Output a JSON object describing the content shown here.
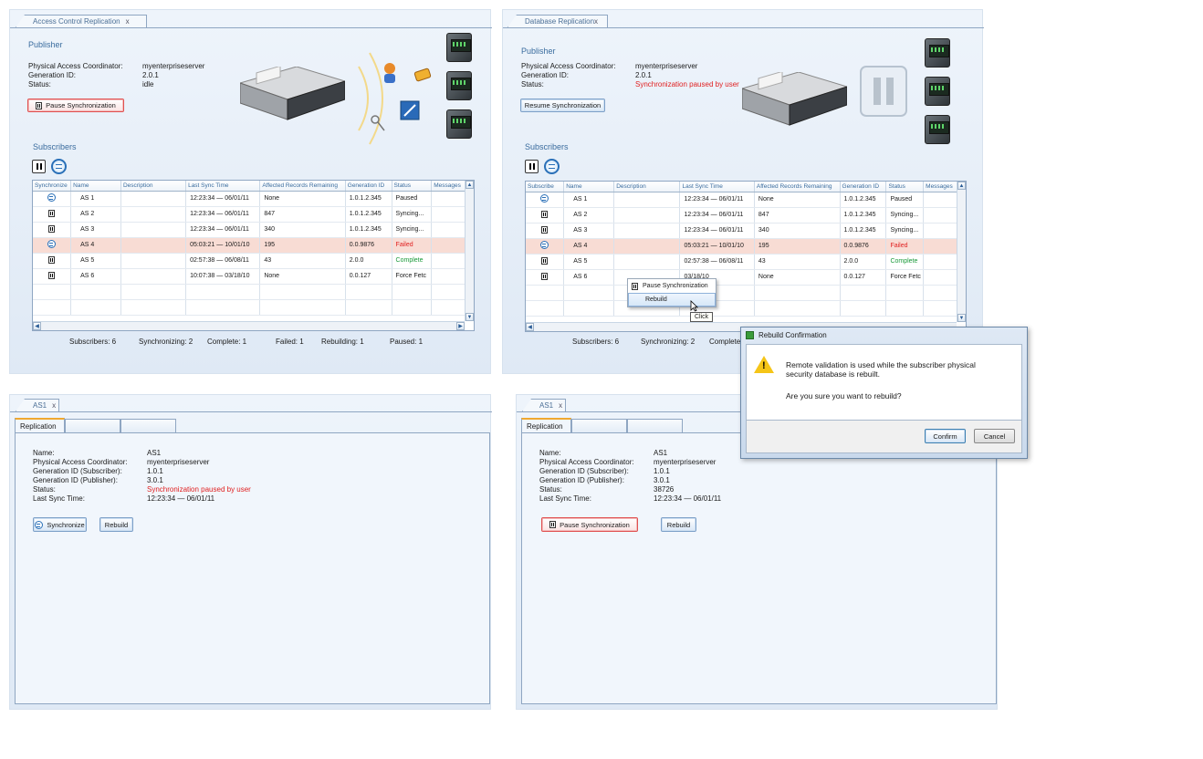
{
  "left_panel": {
    "tab_title": "Access Control Replication",
    "tab_close": "x",
    "publisher_heading": "Publisher",
    "publisher": {
      "pac_label": "Physical Access Coordinator:",
      "pac_value": "myenterpriseserver",
      "gen_label": "Generation ID:",
      "gen_value": "2.0.1",
      "status_label": "Status:",
      "status_value": "idle"
    },
    "action_button": "Pause Synchronization",
    "subscribers_heading": "Subscribers",
    "columns": [
      "Synchronize",
      "Name",
      "Description",
      "Last Sync Time",
      "Affected Records Remaining",
      "Generation ID",
      "Status",
      "Messages"
    ],
    "rows": [
      {
        "icon": "sync",
        "name": "AS 1",
        "desc": "",
        "time": "12:23:34 — 06/01/11",
        "records": "None",
        "gen": "1.0.1.2.345",
        "status": "Paused",
        "status_color": "normal"
      },
      {
        "icon": "pause",
        "name": "AS 2",
        "desc": "",
        "time": "12:23:34 — 06/01/11",
        "records": "847",
        "gen": "1.0.1.2.345",
        "status": "Syncing...",
        "status_color": "normal"
      },
      {
        "icon": "pause",
        "name": "AS 3",
        "desc": "",
        "time": "12:23:34 — 06/01/11",
        "records": "340",
        "gen": "1.0.1.2.345",
        "status": "Syncing...",
        "status_color": "normal"
      },
      {
        "icon": "sync",
        "name": "AS 4",
        "desc": "",
        "time": "05:03:21 — 10/01/10",
        "records": "195",
        "gen": "0.0.9876",
        "status": "Failed",
        "status_color": "red"
      },
      {
        "icon": "pause",
        "name": "AS 5",
        "desc": "",
        "time": "02:57:38 — 06/08/11",
        "records": "43",
        "gen": "2.0.0",
        "status": "Complete",
        "status_color": "green"
      },
      {
        "icon": "pause",
        "name": "AS 6",
        "desc": "",
        "time": "10:07:38 — 03/18/10",
        "records": "None",
        "gen": "0.0.127",
        "status": "Force Fetc",
        "status_color": "normal"
      }
    ],
    "stats": [
      "Subscribers: 6",
      "Synchronizing: 2",
      "Complete: 1",
      "Failed: 1",
      "Rebuilding: 1",
      "Paused: 1"
    ]
  },
  "right_panel": {
    "tab_title": "Database Replication",
    "tab_close": "x",
    "publisher_heading": "Publisher",
    "publisher": {
      "pac_label": "Physical Access Coordinator:",
      "pac_value": "myenterpriseserver",
      "gen_label": "Generation ID:",
      "gen_value": "2.0.1",
      "status_label": "Status:",
      "status_value": "Synchronization paused by user"
    },
    "action_button": "Resume Synchronization",
    "subscribers_heading": "Subscribers",
    "columns": [
      "Subscribe",
      "Name",
      "Description",
      "Last Sync Time",
      "Affected Records Remaining",
      "Generation ID",
      "Status",
      "Messages"
    ],
    "rows": [
      {
        "icon": "sync",
        "name": "AS 1",
        "desc": "",
        "time": "12:23:34 — 06/01/11",
        "records": "None",
        "gen": "1.0.1.2.345",
        "status": "Paused",
        "status_color": "normal"
      },
      {
        "icon": "pause",
        "name": "AS 2",
        "desc": "",
        "time": "12:23:34 — 06/01/11",
        "records": "847",
        "gen": "1.0.1.2.345",
        "status": "Syncing...",
        "status_color": "normal"
      },
      {
        "icon": "pause",
        "name": "AS 3",
        "desc": "",
        "time": "12:23:34 — 06/01/11",
        "records": "340",
        "gen": "1.0.1.2.345",
        "status": "Syncing...",
        "status_color": "normal"
      },
      {
        "icon": "sync",
        "name": "AS 4",
        "desc": "",
        "time": "05:03:21 — 10/01/10",
        "records": "195",
        "gen": "0.0.9876",
        "status": "Failed",
        "status_color": "red"
      },
      {
        "icon": "pause",
        "name": "AS 5",
        "desc": "",
        "time": "02:57:38 — 06/08/11",
        "records": "43",
        "gen": "2.0.0",
        "status": "Complete",
        "status_color": "green"
      },
      {
        "icon": "pause",
        "name": "AS 6",
        "desc": "",
        "time": "03/18/10",
        "records": "None",
        "gen": "0.0.127",
        "status": "Force Fetc",
        "status_color": "normal"
      }
    ],
    "stats": [
      "Subscribers: 6",
      "Synchronizing: 2",
      "Complete"
    ],
    "context_menu": [
      "Pause Synchronization",
      "Rebuild"
    ],
    "tooltip": "Click"
  },
  "dialog": {
    "title": "Rebuild Confirmation",
    "message_1": "Remote validation is used while the subscriber physical",
    "message_2": "security database is rebuilt.",
    "question": "Are you sure you want to rebuild?",
    "confirm": "Confirm",
    "cancel": "Cancel"
  },
  "detail_left": {
    "tab_title": "AS1",
    "tab_close": "x",
    "subtab": "Replication",
    "fields": [
      {
        "label": "Name:",
        "value": "AS1",
        "color": "normal"
      },
      {
        "label": "Physical Access Coordinator:",
        "value": "myenterpriseserver",
        "color": "normal"
      },
      {
        "label": "Generation ID (Subscriber):",
        "value": "1.0.1",
        "color": "normal"
      },
      {
        "label": "Generation ID (Publisher):",
        "value": "3.0.1",
        "color": "normal"
      },
      {
        "label": "Status:",
        "value": "Synchronization paused by user",
        "color": "red"
      },
      {
        "label": "Last Sync Time:",
        "value": "12:23:34 — 06/01/11",
        "color": "normal"
      }
    ],
    "button_1": "Synchronize",
    "button_2": "Rebuild"
  },
  "detail_right": {
    "tab_title": "AS1",
    "tab_close": "x",
    "subtab": "Replication",
    "fields": [
      {
        "label": "Name:",
        "value": "AS1",
        "color": "normal"
      },
      {
        "label": "Physical Access Coordinator:",
        "value": "myenterpriseserver",
        "color": "normal"
      },
      {
        "label": "Generation ID (Subscriber):",
        "value": "1.0.1",
        "color": "normal"
      },
      {
        "label": "Generation ID (Publisher):",
        "value": "3.0.1",
        "color": "normal"
      },
      {
        "label": "Status:",
        "value": "38726",
        "color": "normal"
      },
      {
        "label": "Last Sync Time:",
        "value": "12:23:34 — 06/01/11",
        "color": "normal"
      }
    ],
    "button_1": "Pause Synchronization",
    "button_2": "Rebuild"
  },
  "colors": {
    "accent": "#3a6c9e",
    "failed": "#e02020",
    "complete": "#1a9a3a",
    "selected_row": "#f8dcd4"
  }
}
